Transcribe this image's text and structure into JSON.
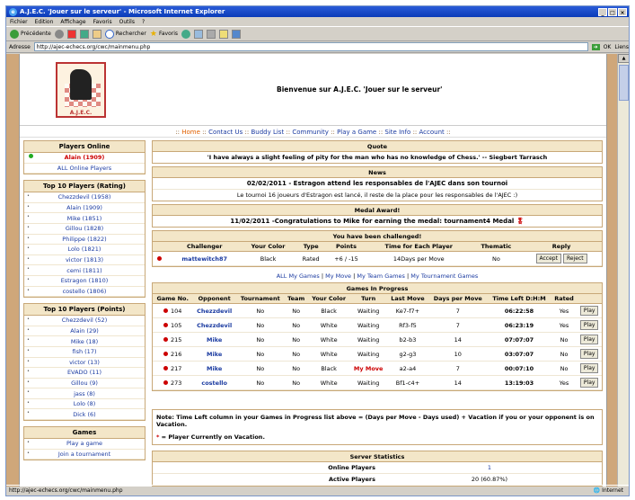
{
  "window": {
    "title": "A.J.E.C. 'Jouer sur le serveur' - Microsoft Internet Explorer"
  },
  "menu": [
    "Fichier",
    "Edition",
    "Affichage",
    "Favoris",
    "Outils",
    "?"
  ],
  "toolbar": {
    "back": "Précédente",
    "search": "Rechercher",
    "favorites": "Favoris"
  },
  "address": {
    "label": "Adresse",
    "url": "http://ajec-echecs.org/cwc/mainmenu.php",
    "go": "OK",
    "links": "Liens"
  },
  "header": {
    "logo_caption": "A.J.E.C.",
    "welcome": "Bienvenue sur A.J.E.C. 'Jouer sur le serveur'"
  },
  "nav": [
    "Home",
    "Contact Us",
    "Buddy List",
    "Community",
    "Play a Game",
    "Site Info",
    "Account"
  ],
  "players_online": {
    "title": "Players Online",
    "items": [
      "Alain (1909)",
      "ALL Online Players"
    ]
  },
  "top10_rating": {
    "title": "Top 10 Players (Rating)",
    "items": [
      "Chezzdevil (1958)",
      "Alain (1909)",
      "Mike (1851)",
      "Gillou (1828)",
      "Philippe (1822)",
      "Lolo (1821)",
      "victor (1813)",
      "cemi (1811)",
      "Estragon (1810)",
      "costello (1806)"
    ]
  },
  "top10_points": {
    "title": "Top 10 Players (Points)",
    "items": [
      "Chezzdevil (52)",
      "Alain (29)",
      "Mike (18)",
      "fish (17)",
      "victor (13)",
      "EVADO (11)",
      "Gillou (9)",
      "jass (8)",
      "Lolo (8)",
      "Dick (6)"
    ]
  },
  "games_box": {
    "title": "Games",
    "items": [
      "Play a game",
      "Join a tournament"
    ]
  },
  "quote": {
    "title": "Quote",
    "text": "'I have always a slight feeling of pity for the man who has no knowledge of Chess.' -- Siegbert Tarrasch"
  },
  "news": {
    "title": "News",
    "headline": "02/02/2011 - Estragon attend les responsables de l'AJEC dans son tournoi",
    "body": "Le tournoi 16 joueurs d'Estragon est lancé, il reste de la place pour les responsables de l'AJEC :)"
  },
  "medal": {
    "title": "Medal Award!",
    "text": "11/02/2011 -Congratulations to Mike for earning the medal: tournament4 Medal"
  },
  "challenge": {
    "title": "You have been challenged!",
    "headers": [
      "Challenger",
      "Your Color",
      "Type",
      "Points",
      "Time for Each Player",
      "Thematic",
      "Reply"
    ],
    "row": {
      "challenger": "mattewitch87",
      "color": "Black",
      "type": "Rated",
      "points": "+6 / -15",
      "time": "14Days per Move",
      "thematic": "No",
      "accept": "Accept",
      "reject": "Reject"
    }
  },
  "game_tabs": [
    "ALL My Games",
    "My Move",
    "My Team Games",
    "My Tournament Games"
  ],
  "games": {
    "title": "Games In Progress",
    "headers": [
      "Game No.",
      "Opponent",
      "Tournament",
      "Team",
      "Your Color",
      "Turn",
      "Last Move",
      "Days per Move",
      "Time Left D:H:M",
      "Rated",
      ""
    ],
    "rows": [
      {
        "no": "104",
        "opp": "Chezzdevil",
        "tour": "No",
        "team": "No",
        "color": "Black",
        "turn": "Waiting",
        "last": "Ke7-f7+",
        "days": "7",
        "left": "06:22:58",
        "rated": "Yes",
        "play": "Play"
      },
      {
        "no": "105",
        "opp": "Chezzdevil",
        "tour": "No",
        "team": "No",
        "color": "White",
        "turn": "Waiting",
        "last": "Rf3-f5",
        "days": "7",
        "left": "06:23:19",
        "rated": "Yes",
        "play": "Play"
      },
      {
        "no": "215",
        "opp": "Mike",
        "tour": "No",
        "team": "No",
        "color": "White",
        "turn": "Waiting",
        "last": "b2-b3",
        "days": "14",
        "left": "07:07:07",
        "rated": "No",
        "play": "Play"
      },
      {
        "no": "216",
        "opp": "Mike",
        "tour": "No",
        "team": "No",
        "color": "White",
        "turn": "Waiting",
        "last": "g2-g3",
        "days": "10",
        "left": "03:07:07",
        "rated": "No",
        "play": "Play"
      },
      {
        "no": "217",
        "opp": "Mike",
        "tour": "No",
        "team": "No",
        "color": "Black",
        "turn": "My Move",
        "last": "a2-a4",
        "days": "7",
        "left": "00:07:10",
        "rated": "No",
        "play": "Play"
      },
      {
        "no": "273",
        "opp": "costello",
        "tour": "No",
        "team": "No",
        "color": "White",
        "turn": "Waiting",
        "last": "Bf1-c4+",
        "days": "14",
        "left": "13:19:03",
        "rated": "Yes",
        "play": "Play"
      }
    ]
  },
  "note": {
    "text": "Note: Time Left column in your Games in Progress list above = (Days per Move - Days used) + Vacation if you or your opponent is on Vacation.",
    "vacation_star": "*",
    "vacation_text": "= Player Currently on Vacation."
  },
  "stats": {
    "title": "Server Statistics",
    "rows": [
      {
        "label": "Online Players",
        "value": "1"
      },
      {
        "label": "Active Players",
        "value": "20 (60.87%)"
      }
    ]
  },
  "status": {
    "url": "http://ajec-echecs.org/cwc/mainmenu.php",
    "zone": "Internet"
  }
}
